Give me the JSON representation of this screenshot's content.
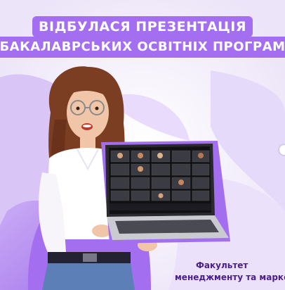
{
  "headline": {
    "line1": "ВІДБУЛАСЯ ПРЕЗЕНТАЦІЯ",
    "line2": "БАКАЛАВРСЬКИХ ОСВІТНІХ ПРОГРАМ"
  },
  "faculty": {
    "line1": "Факультет",
    "line2": "менеджменту та маркетингу"
  },
  "colors": {
    "accent": "#a36ff0",
    "accent_dark": "#8a4fe0",
    "faculty_text": "#4a1f8a",
    "background": "#f3f0f8"
  },
  "icons": {
    "carousel_next": "chevron-right-icon"
  }
}
